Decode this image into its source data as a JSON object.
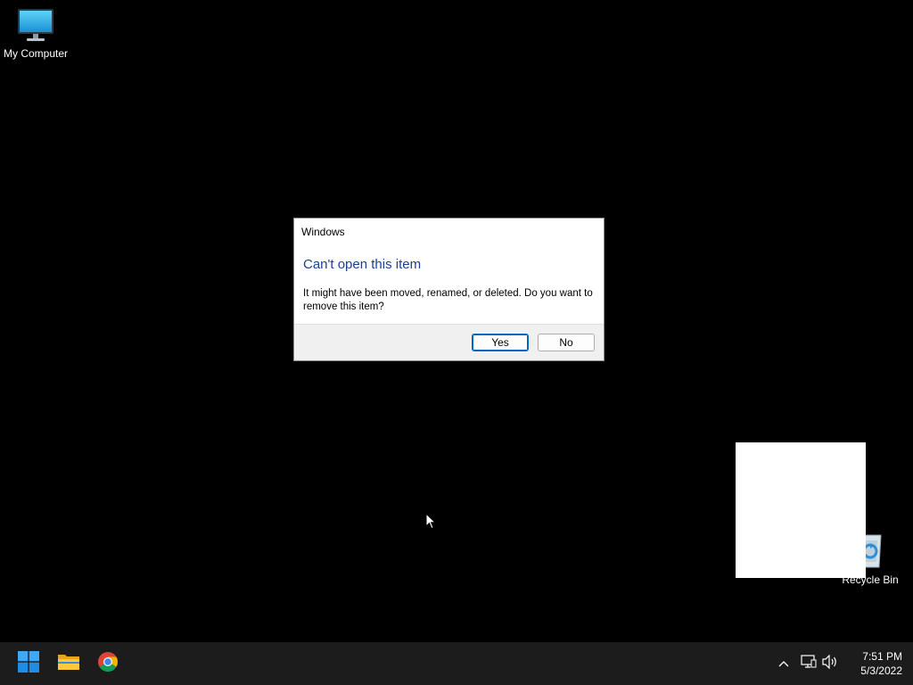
{
  "desktop": {
    "icons": [
      {
        "label": "My Computer",
        "icon": "monitor-icon"
      },
      {
        "label": "Recycle Bin",
        "icon": "recycle-bin-icon"
      }
    ]
  },
  "dialog": {
    "title": "Windows",
    "heading": "Can't open this item",
    "message": "It might have been moved, renamed, or deleted. Do you want to remove this item?",
    "buttons": {
      "yes": "Yes",
      "no": "No"
    },
    "colors": {
      "heading": "#1c3f94",
      "default_button_border": "#0067c0"
    }
  },
  "taskbar": {
    "pinned": [
      {
        "name": "Start",
        "icon": "windows-start-icon"
      },
      {
        "name": "File Explorer",
        "icon": "folder-icon"
      },
      {
        "name": "Google Chrome",
        "icon": "chrome-icon"
      }
    ],
    "tray": {
      "icons": [
        "chevron-up-icon",
        "network-icon",
        "volume-icon"
      ]
    },
    "clock": {
      "time": "7:51 PM",
      "date": "5/3/2022"
    },
    "colors": {
      "background": "#1c1c1c"
    }
  }
}
